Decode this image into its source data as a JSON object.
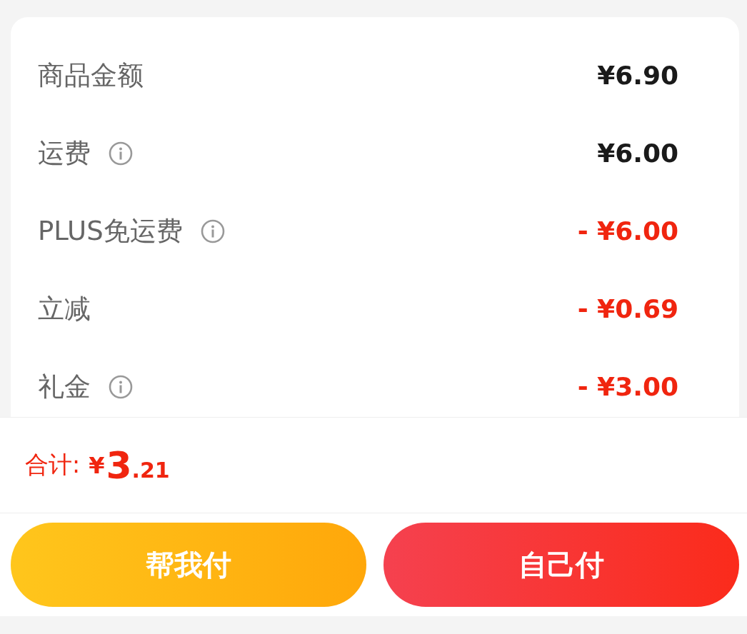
{
  "fees": [
    {
      "label": "商品金额",
      "info": false,
      "kind": "charge",
      "value": "¥6.90"
    },
    {
      "label": "运费",
      "info": true,
      "kind": "charge",
      "value": "¥6.00"
    },
    {
      "label": "PLUS免运费",
      "info": true,
      "kind": "discount",
      "value": "- ¥6.00"
    },
    {
      "label": "立减",
      "info": false,
      "kind": "discount",
      "value": "- ¥0.69"
    },
    {
      "label": "礼金",
      "info": true,
      "kind": "discount",
      "value": "- ¥3.00"
    }
  ],
  "total": {
    "label": "合计:",
    "currency": "¥",
    "integer": "3",
    "decimal": ".21"
  },
  "buttons": [
    {
      "label": "帮我付",
      "kind": "friend"
    },
    {
      "label": "自己付",
      "kind": "self"
    }
  ]
}
